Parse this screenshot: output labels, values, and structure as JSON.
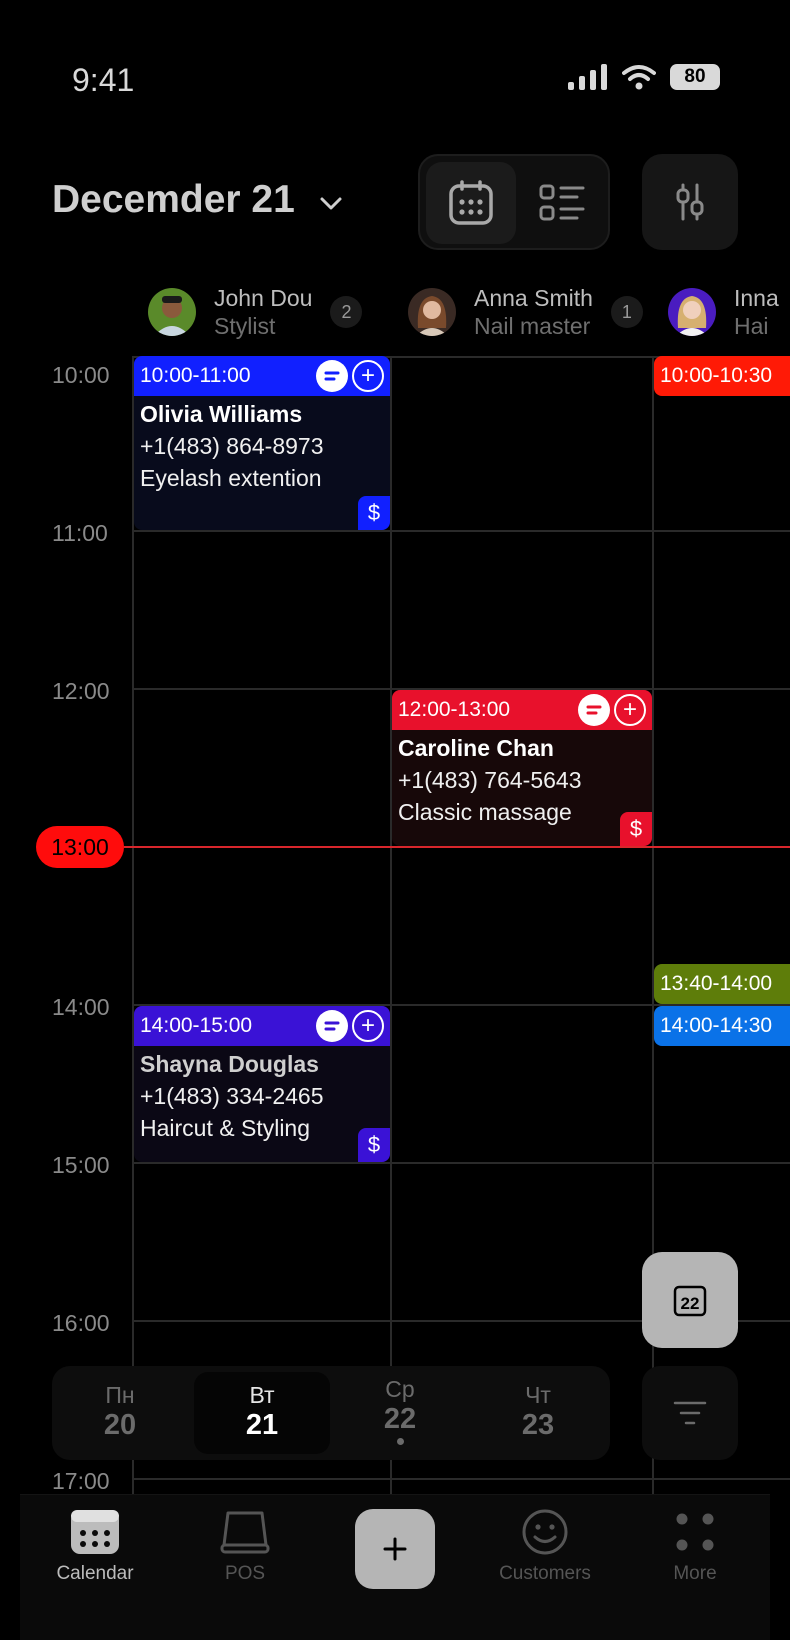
{
  "status": {
    "time": "9:41",
    "battery": "80"
  },
  "header": {
    "date": "Decemder 21"
  },
  "staff": [
    {
      "name": "John Dou",
      "role": "Stylist",
      "count": "2"
    },
    {
      "name": "Anna Smith",
      "role": "Nail master",
      "count": "1"
    },
    {
      "name": "Inna",
      "role": "Hai"
    }
  ],
  "hours": [
    "10:00",
    "11:00",
    "12:00",
    "13:00",
    "14:00",
    "15:00",
    "16:00",
    "17:00"
  ],
  "now": "13:00",
  "appointments": [
    {
      "time": "10:00-11:00",
      "client": "Olivia Williams",
      "phone": "+1(483) 864-8973",
      "service": "Eyelash extention",
      "color": "#1120ff",
      "body_color": "#080b1c"
    },
    {
      "time": "12:00-13:00",
      "client": "Caroline Chan",
      "phone": "+1(483) 764-5643",
      "service": "Classic massage",
      "color": "#e8112c",
      "body_color": "#170809"
    },
    {
      "time": "14:00-15:00",
      "client": "Shayna Douglas",
      "phone": "+1(483) 334-2465",
      "service": "Haircut & Styling",
      "color": "#3a12d6",
      "body_color": "#0b0815"
    }
  ],
  "third_column": [
    {
      "time": "10:00-10:30",
      "color": "#ff1a06"
    },
    {
      "time": "13:40-14:00",
      "color": "#5e7d0a"
    },
    {
      "time": "14:00-14:30",
      "color": "#0a72e8"
    }
  ],
  "today_button": "22",
  "week": [
    {
      "name": "Пн",
      "num": "20"
    },
    {
      "name": "Вт",
      "num": "21",
      "selected": true
    },
    {
      "name": "Ср",
      "num": "22",
      "dot": true
    },
    {
      "name": "Чт",
      "num": "23"
    }
  ],
  "tabs": [
    {
      "label": "Calendar",
      "icon": "calendar-icon",
      "active": true
    },
    {
      "label": "POS",
      "icon": "pos-terminal-icon"
    },
    {
      "label": "Customers",
      "icon": "smiley-icon"
    },
    {
      "label": "More",
      "icon": "more-dots-icon"
    }
  ],
  "symbols": {
    "payment": "$",
    "plus": "+"
  }
}
